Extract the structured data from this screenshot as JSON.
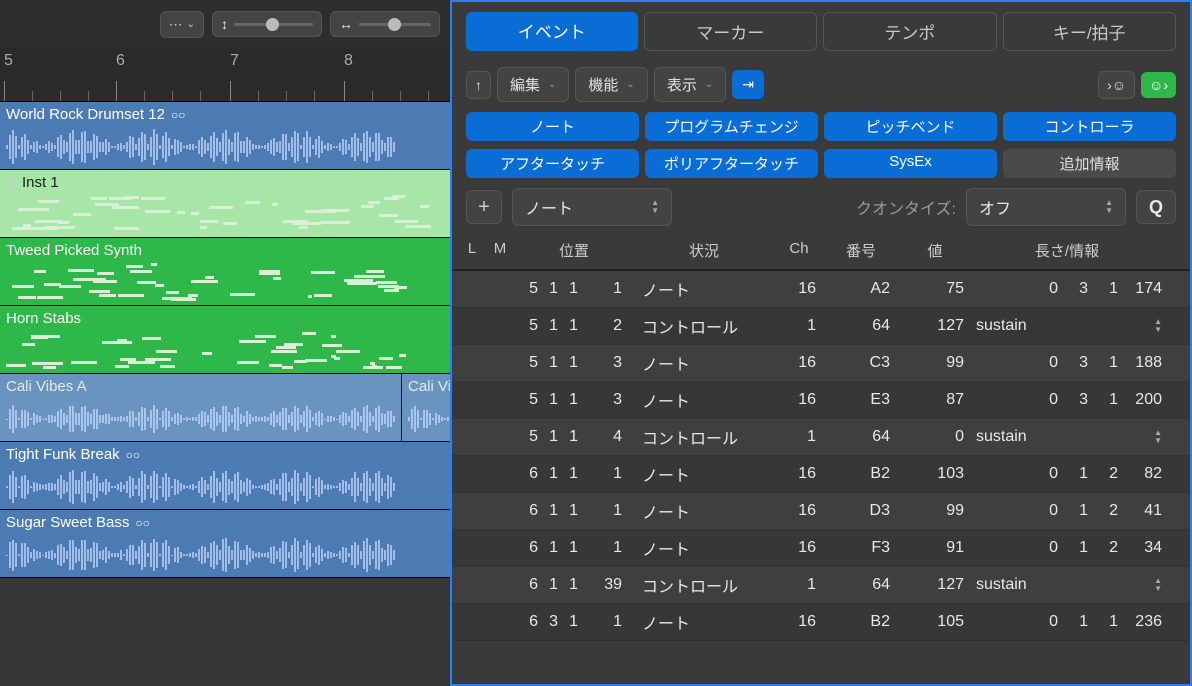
{
  "tabs": {
    "event": "イベント",
    "marker": "マーカー",
    "tempo": "テンポ",
    "key": "キー/拍子"
  },
  "menus": {
    "edit": "編集",
    "function": "機能",
    "view": "表示"
  },
  "filters": {
    "note": "ノート",
    "program_change": "プログラムチェンジ",
    "pitch_bend": "ピッチベンド",
    "controller": "コントローラ",
    "aftertouch": "アフタータッチ",
    "poly_aftertouch": "ポリアフタータッチ",
    "sysex": "SysEx",
    "additional": "追加情報"
  },
  "quant": {
    "add_type": "ノート",
    "label": "クオンタイズ:",
    "value": "オフ",
    "q_btn": "Q"
  },
  "columns": {
    "l": "L",
    "m": "M",
    "position": "位置",
    "status": "状況",
    "ch": "Ch",
    "number": "番号",
    "value": "値",
    "length": "長さ/情報"
  },
  "events": [
    {
      "pos": [
        "5",
        "1",
        "1",
        "1"
      ],
      "status": "ノート",
      "ch": 16,
      "num": "A2",
      "val": 75,
      "info": [
        "0",
        "3",
        "1",
        "174"
      ],
      "type": "note"
    },
    {
      "pos": [
        "5",
        "1",
        "1",
        "2"
      ],
      "status": "コントロール",
      "ch": 1,
      "num": "64",
      "val": 127,
      "info": "sustain",
      "type": "ctrl"
    },
    {
      "pos": [
        "5",
        "1",
        "1",
        "3"
      ],
      "status": "ノート",
      "ch": 16,
      "num": "C3",
      "val": 99,
      "info": [
        "0",
        "3",
        "1",
        "188"
      ],
      "type": "note"
    },
    {
      "pos": [
        "5",
        "1",
        "1",
        "3"
      ],
      "status": "ノート",
      "ch": 16,
      "num": "E3",
      "val": 87,
      "info": [
        "0",
        "3",
        "1",
        "200"
      ],
      "type": "note"
    },
    {
      "pos": [
        "5",
        "1",
        "1",
        "4"
      ],
      "status": "コントロール",
      "ch": 1,
      "num": "64",
      "val": 0,
      "info": "sustain",
      "type": "ctrl"
    },
    {
      "pos": [
        "6",
        "1",
        "1",
        "1"
      ],
      "status": "ノート",
      "ch": 16,
      "num": "B2",
      "val": 103,
      "info": [
        "0",
        "1",
        "2",
        "82"
      ],
      "type": "note"
    },
    {
      "pos": [
        "6",
        "1",
        "1",
        "1"
      ],
      "status": "ノート",
      "ch": 16,
      "num": "D3",
      "val": 99,
      "info": [
        "0",
        "1",
        "2",
        "41"
      ],
      "type": "note"
    },
    {
      "pos": [
        "6",
        "1",
        "1",
        "1"
      ],
      "status": "ノート",
      "ch": 16,
      "num": "F3",
      "val": 91,
      "info": [
        "0",
        "1",
        "2",
        "34"
      ],
      "type": "note"
    },
    {
      "pos": [
        "6",
        "1",
        "1",
        "39"
      ],
      "status": "コントロール",
      "ch": 1,
      "num": "64",
      "val": 127,
      "info": "sustain",
      "type": "ctrl"
    },
    {
      "pos": [
        "6",
        "3",
        "1",
        "1"
      ],
      "status": "ノート",
      "ch": 16,
      "num": "B2",
      "val": 105,
      "info": [
        "0",
        "1",
        "1",
        "236"
      ],
      "type": "note"
    }
  ],
  "ruler": {
    "marks": [
      5,
      6,
      7,
      8
    ]
  },
  "tracks": [
    {
      "name": "World Rock Drumset 12",
      "type": "blue",
      "loop": true
    },
    {
      "name": "Inst 1",
      "type": "green-light"
    },
    {
      "name": "Tweed Picked Synth",
      "type": "green"
    },
    {
      "name": "Horn Stabs",
      "type": "green"
    },
    {
      "split": true,
      "a": "Cali Vibes A",
      "b": "Cali Vibes Wah Guitar",
      "loop": true
    },
    {
      "name": "Tight Funk Break",
      "type": "blue",
      "loop": true
    },
    {
      "name": "Sugar Sweet Bass",
      "type": "blue",
      "loop": true
    }
  ]
}
